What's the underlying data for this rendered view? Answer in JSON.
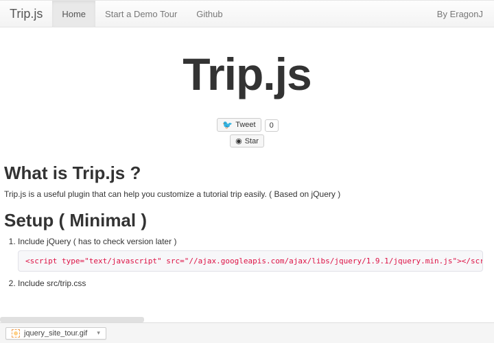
{
  "nav": {
    "brand": "Trip.js",
    "items": [
      "Home",
      "Start a Demo Tour",
      "Github"
    ],
    "active_index": 0,
    "byline": "By EragonJ"
  },
  "hero": {
    "title": "Trip.js"
  },
  "social": {
    "tweet_label": "Tweet",
    "tweet_count": "0",
    "star_label": "Star"
  },
  "sections": {
    "what_heading": "What is Trip.js ?",
    "what_body": "Trip.js is a useful plugin that can help you customize a tutorial trip easily. ( Based on jQuery )",
    "setup_heading": "Setup ( Minimal )",
    "setup_steps": [
      "Include jQuery ( has to check version later )",
      "Include src/trip.css"
    ],
    "setup_code_1": "<script type=\"text/javascript\" src=\"//ajax.googleapis.com/ajax/libs/jquery/1.9.1/jquery.min.js\"></script>"
  },
  "download": {
    "filename": "jquery_site_tour.gif"
  }
}
